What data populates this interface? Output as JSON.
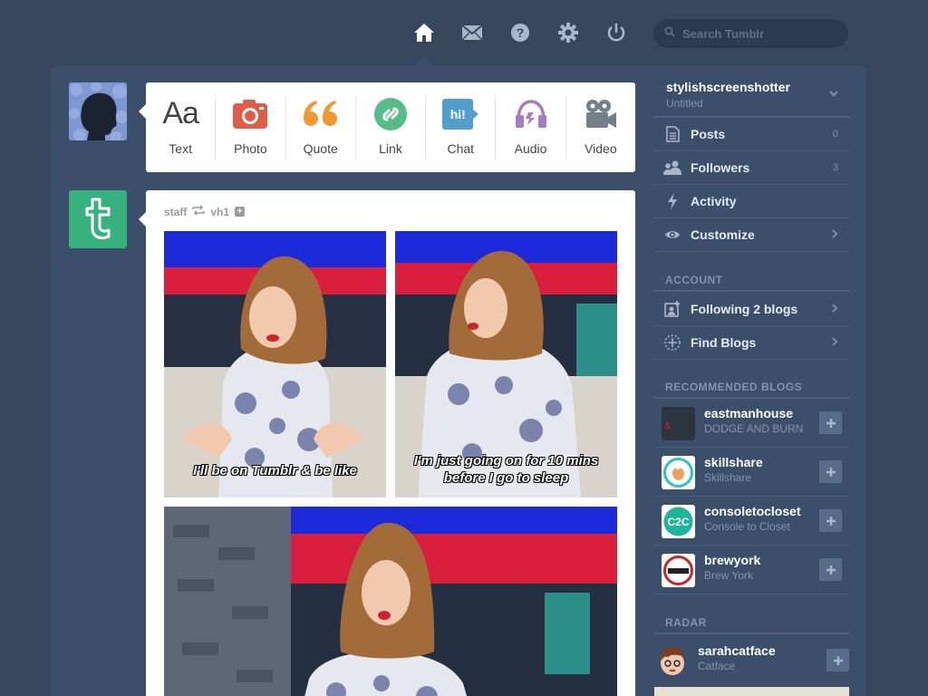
{
  "search": {
    "placeholder": "Search Tumblr"
  },
  "post_types": [
    {
      "label": "Text",
      "glyph": "Aa"
    },
    {
      "label": "Photo"
    },
    {
      "label": "Quote",
      "glyph": "❛❛"
    },
    {
      "label": "Link"
    },
    {
      "label": "Chat",
      "glyph": "hi!"
    },
    {
      "label": "Audio"
    },
    {
      "label": "Video"
    }
  ],
  "post": {
    "author": "staff",
    "reblogged_from": "vh1",
    "captions": [
      [
        "I'll be on Tumblr & be like"
      ],
      [
        "I'm just going on for 10 mins",
        "before I go to sleep"
      ]
    ]
  },
  "sidebar": {
    "blog_name": "stylishscreenshotter",
    "blog_sub": "Untitled",
    "rows": [
      {
        "label": "Posts",
        "count": "0"
      },
      {
        "label": "Followers",
        "count": "3"
      },
      {
        "label": "Activity"
      },
      {
        "label": "Customize"
      }
    ],
    "account_title": "ACCOUNT",
    "account_rows": [
      {
        "label": "Following 2 blogs"
      },
      {
        "label": "Find Blogs"
      }
    ],
    "recommended_title": "RECOMMENDED BLOGS",
    "recommended": [
      {
        "name": "eastmanhouse",
        "sub": "DODGE AND BURN"
      },
      {
        "name": "skillshare",
        "sub": "Skillshare"
      },
      {
        "name": "consoletocloset",
        "sub": "Console to Closet",
        "badge": "C2C"
      },
      {
        "name": "brewyork",
        "sub": "Brew York"
      }
    ],
    "radar_title": "RADAR",
    "radar": {
      "name": "sarahcatface",
      "sub": "Catface"
    }
  },
  "colors": {
    "background": "#36465d",
    "panel": "#3b4f6b",
    "text_type": "#444444",
    "photo": "#e05e47",
    "quote": "#f2992e",
    "link": "#56bc8a",
    "chat": "#529ecc",
    "audio": "#a77dc2",
    "video": "#748089",
    "tumblr_green": "#37b27e"
  }
}
